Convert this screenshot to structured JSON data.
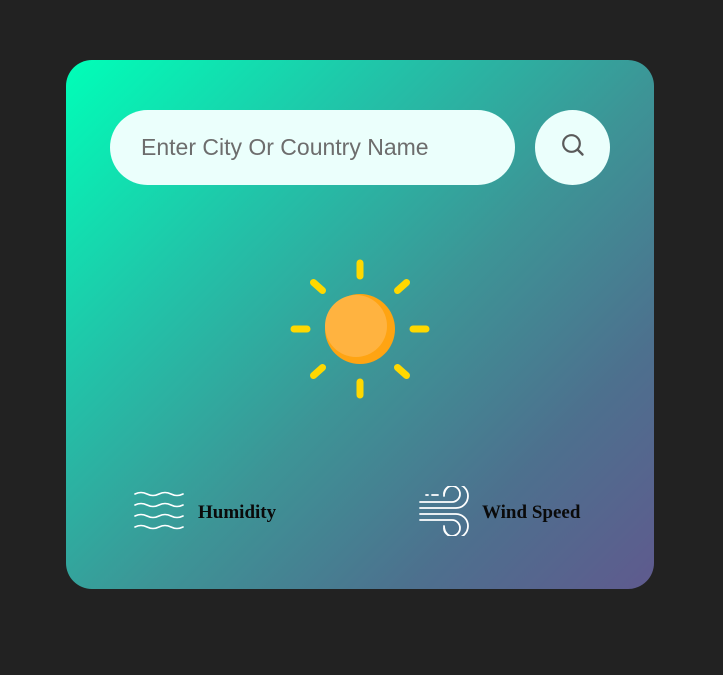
{
  "search": {
    "placeholder": "Enter City Or Country Name",
    "value": ""
  },
  "weather": {
    "icon": "sun-icon"
  },
  "details": {
    "humidity_label": "Humidity",
    "wind_label": "Wind Speed"
  },
  "colors": {
    "page_background": "#222222",
    "gradient_start": "#00ffb8",
    "gradient_end": "#5f5a8e",
    "input_background": "#ebfffc",
    "sun_core": "#ffb13f",
    "sun_rays": "#ffd800"
  }
}
